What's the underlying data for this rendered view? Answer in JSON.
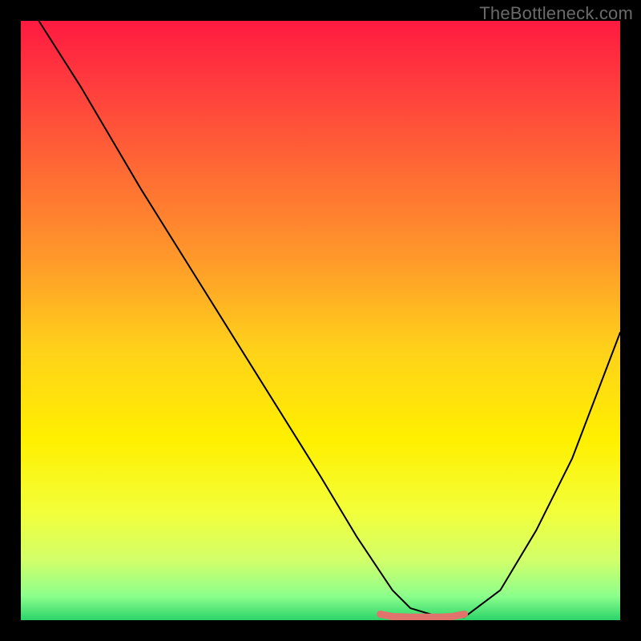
{
  "watermark": "TheBottleneck.com",
  "chart_data": {
    "type": "line",
    "title": "",
    "xlabel": "",
    "ylabel": "",
    "xlim": [
      0,
      100
    ],
    "ylim": [
      0,
      100
    ],
    "grid": false,
    "legend": false,
    "gradient_stops": [
      {
        "pos": 0.0,
        "color": "#ff1a40"
      },
      {
        "pos": 0.1,
        "color": "#ff3a3e"
      },
      {
        "pos": 0.25,
        "color": "#ff6a34"
      },
      {
        "pos": 0.4,
        "color": "#ff9a2a"
      },
      {
        "pos": 0.55,
        "color": "#ffd21a"
      },
      {
        "pos": 0.7,
        "color": "#fff000"
      },
      {
        "pos": 0.82,
        "color": "#f2ff3a"
      },
      {
        "pos": 0.9,
        "color": "#d2ff6a"
      },
      {
        "pos": 0.96,
        "color": "#8cff8c"
      },
      {
        "pos": 1.0,
        "color": "#2bd46a"
      }
    ],
    "series": [
      {
        "name": "curve",
        "color": "#000000",
        "type": "line",
        "x": [
          3,
          10,
          20,
          30,
          40,
          50,
          56,
          60,
          62,
          65,
          70,
          72,
          74,
          80,
          86,
          92,
          100
        ],
        "y": [
          100,
          89,
          72,
          56,
          40,
          24,
          14,
          8,
          5,
          2,
          0.5,
          0.5,
          0.5,
          5,
          15,
          27,
          48
        ]
      },
      {
        "name": "bottom-band",
        "color": "#e0736c",
        "type": "line",
        "x": [
          60,
          62,
          65,
          68,
          70,
          72,
          74
        ],
        "y": [
          1,
          0.6,
          0.5,
          0.5,
          0.5,
          0.6,
          1
        ]
      }
    ],
    "annotations": []
  }
}
